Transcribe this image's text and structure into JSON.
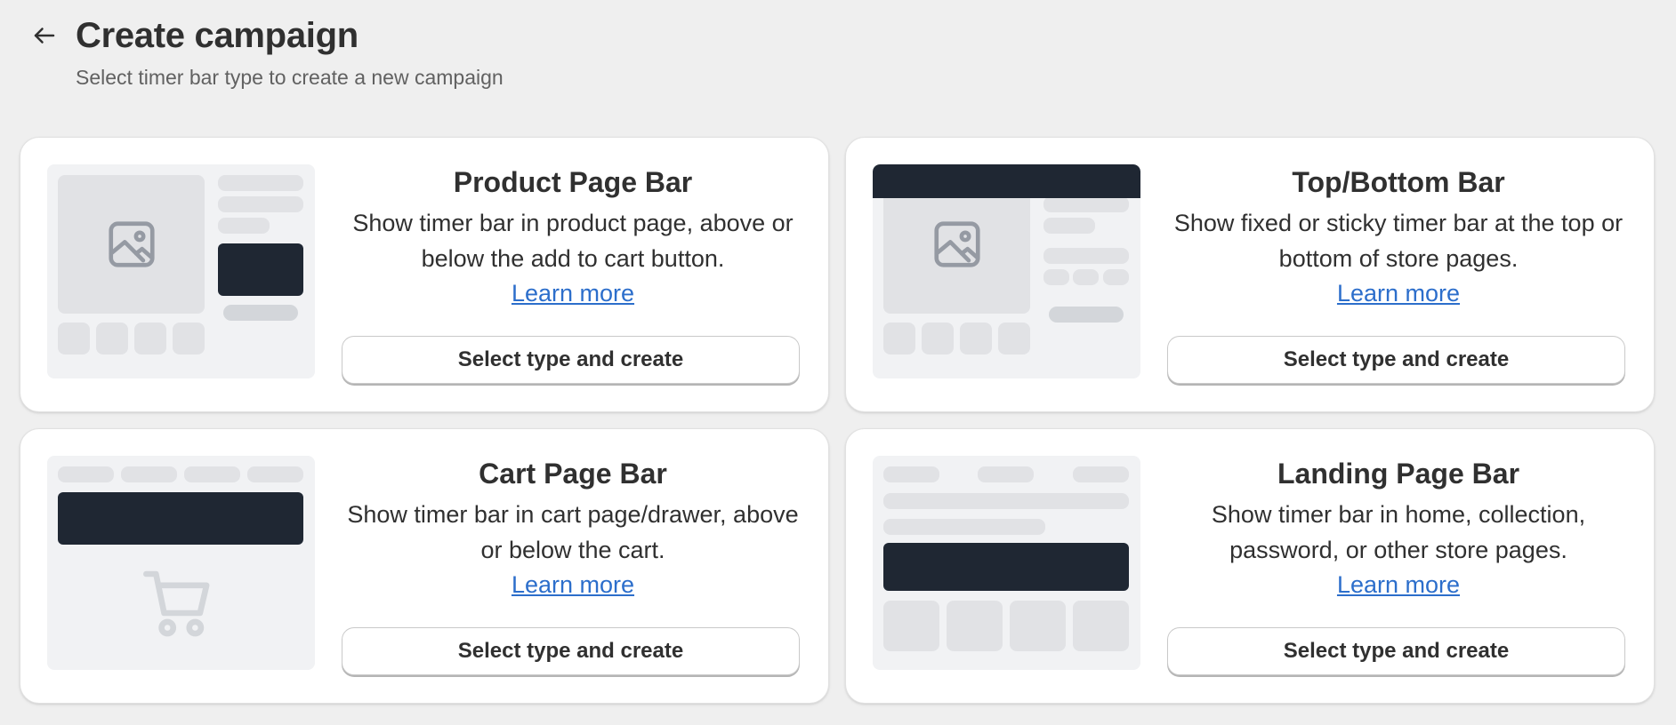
{
  "header": {
    "title": "Create campaign",
    "subtitle": "Select timer bar type to create a new campaign"
  },
  "cards": [
    {
      "title": "Product Page Bar",
      "description": "Show timer bar in product page, above or below the add to cart button.",
      "link_label": "Learn more",
      "button_label": "Select type and create",
      "illustration": "product-page-illustration"
    },
    {
      "title": "Top/Bottom Bar",
      "description": "Show fixed or sticky timer bar at the top or bottom of store pages.",
      "link_label": "Learn more",
      "button_label": "Select type and create",
      "illustration": "top-bottom-illustration"
    },
    {
      "title": "Cart Page Bar",
      "description": "Show timer bar in cart page/drawer, above or below the cart.",
      "link_label": "Learn more",
      "button_label": "Select type and create",
      "illustration": "cart-page-illustration"
    },
    {
      "title": "Landing Page Bar",
      "description": "Show timer bar in home, collection, password, or other store pages.",
      "link_label": "Learn more",
      "button_label": "Select type and create",
      "illustration": "landing-page-illustration"
    }
  ],
  "colors": {
    "background": "#efefef",
    "link": "#2c6ecb",
    "dark_block": "#1f2733",
    "illustration_bg": "#f1f2f4"
  }
}
